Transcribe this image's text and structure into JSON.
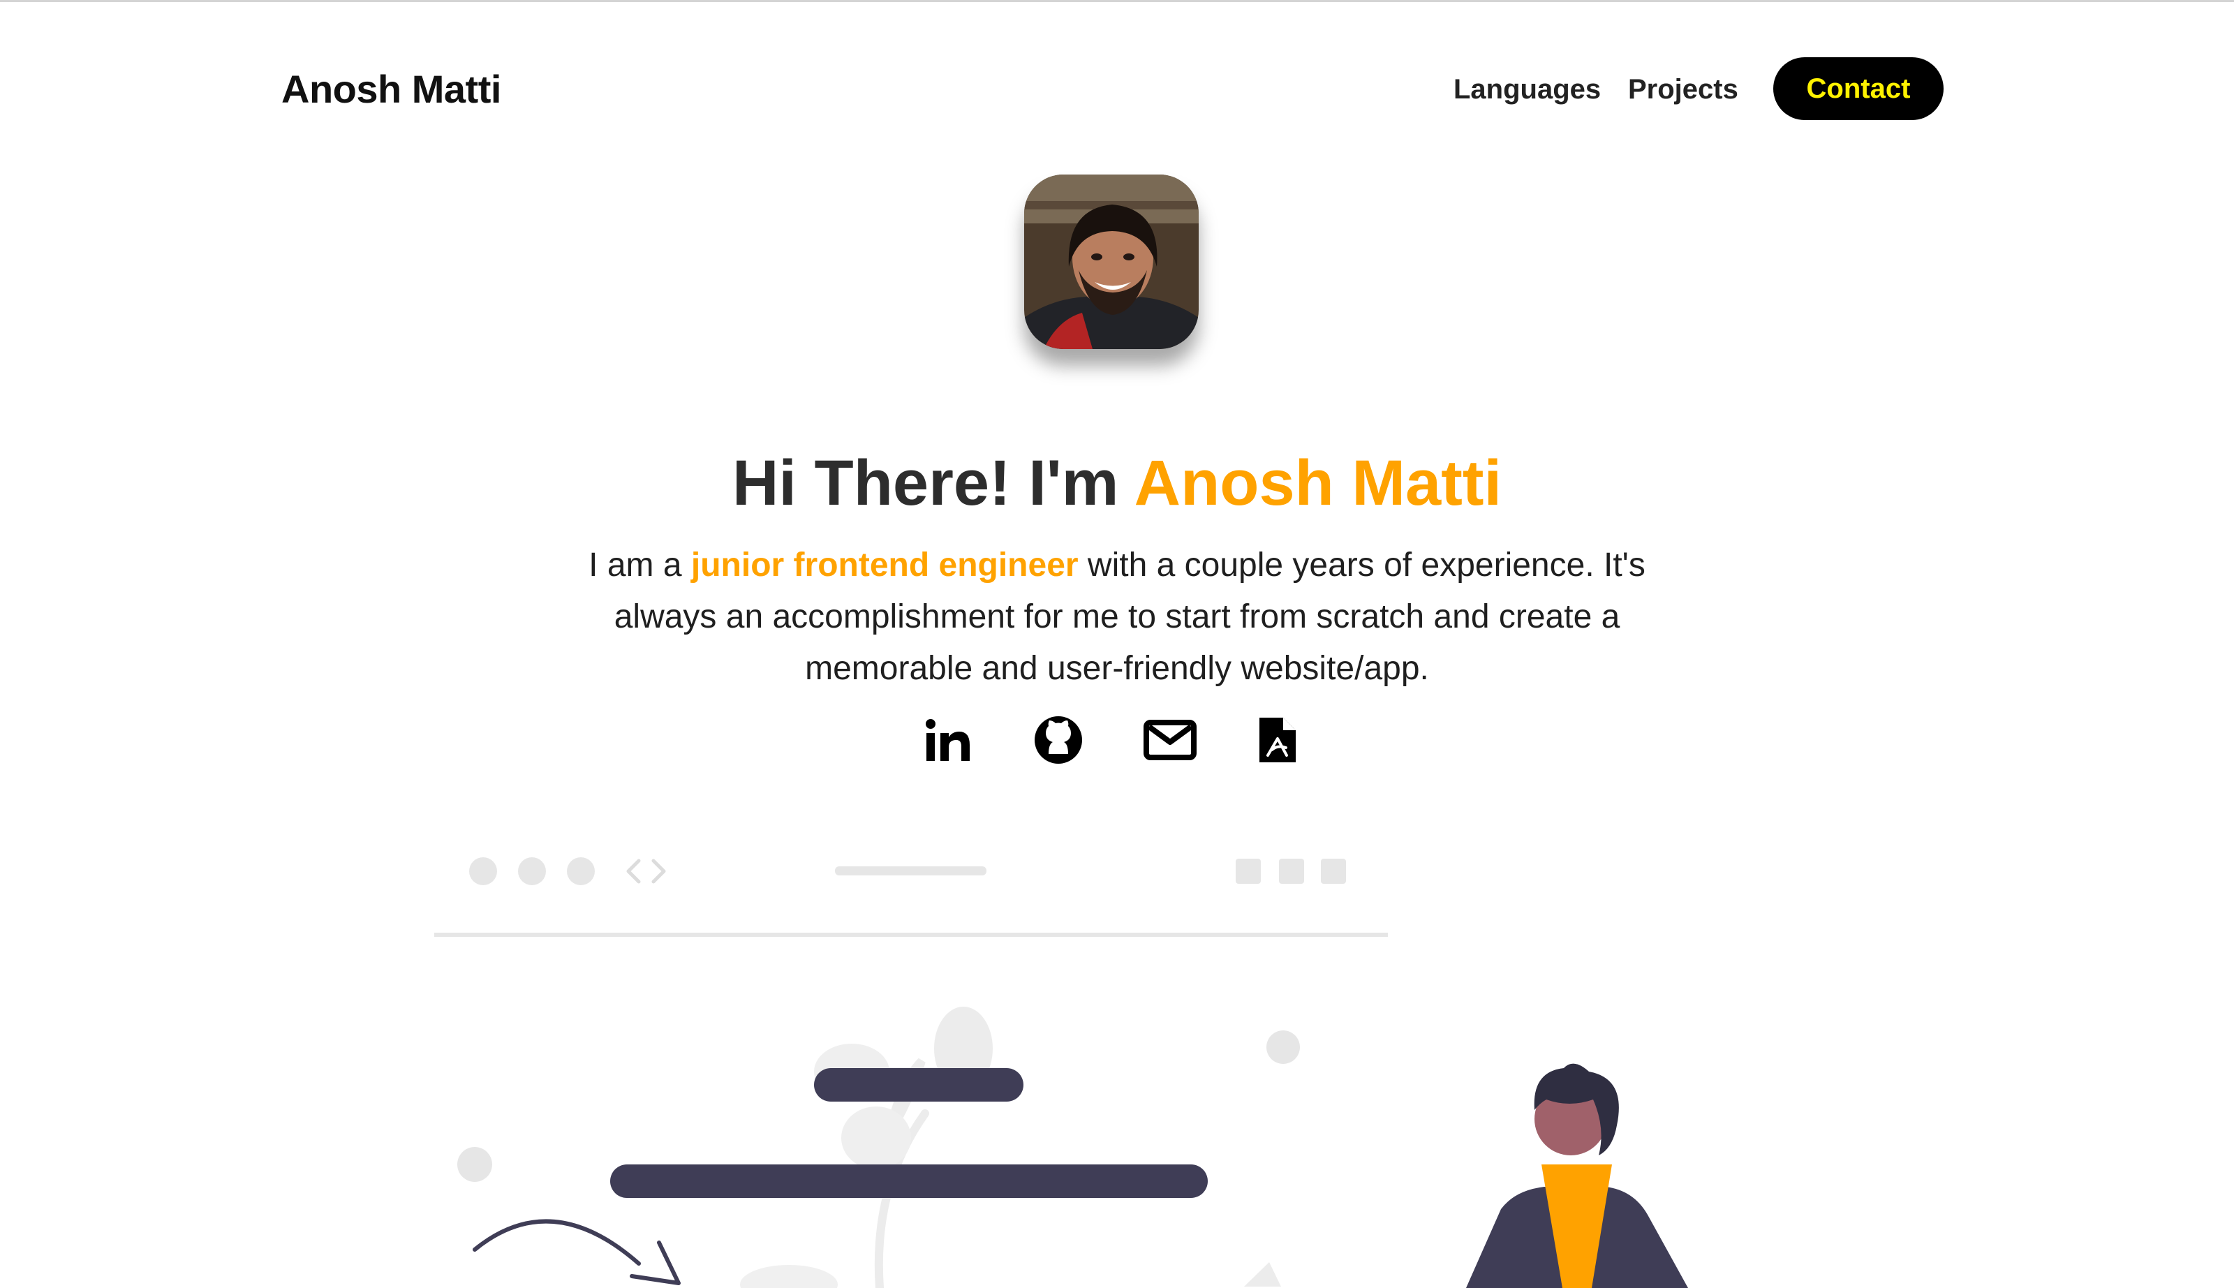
{
  "header": {
    "brand": "Anosh Matti",
    "nav": {
      "languages": "Languages",
      "projects": "Projects",
      "contact": "Contact"
    }
  },
  "hero": {
    "greeting": "Hi There! I'm",
    "name": "Anosh Matti",
    "intro_before": "I am a",
    "intro_highlight": "junior frontend engineer",
    "intro_after": "with a couple years of experience. It's always an accomplishment for me to start from scratch and create a memorable and user-friendly website/app."
  },
  "social_links": [
    {
      "icon": "linkedin-icon"
    },
    {
      "icon": "github-icon"
    },
    {
      "icon": "mail-icon"
    },
    {
      "icon": "pdf-resume-icon"
    }
  ],
  "colors": {
    "accent": "#ffa200",
    "contact_text": "#fff200",
    "contact_bg": "#000000",
    "illustration_dark": "#3f3d56",
    "illustration_light": "#e6e6e6"
  }
}
